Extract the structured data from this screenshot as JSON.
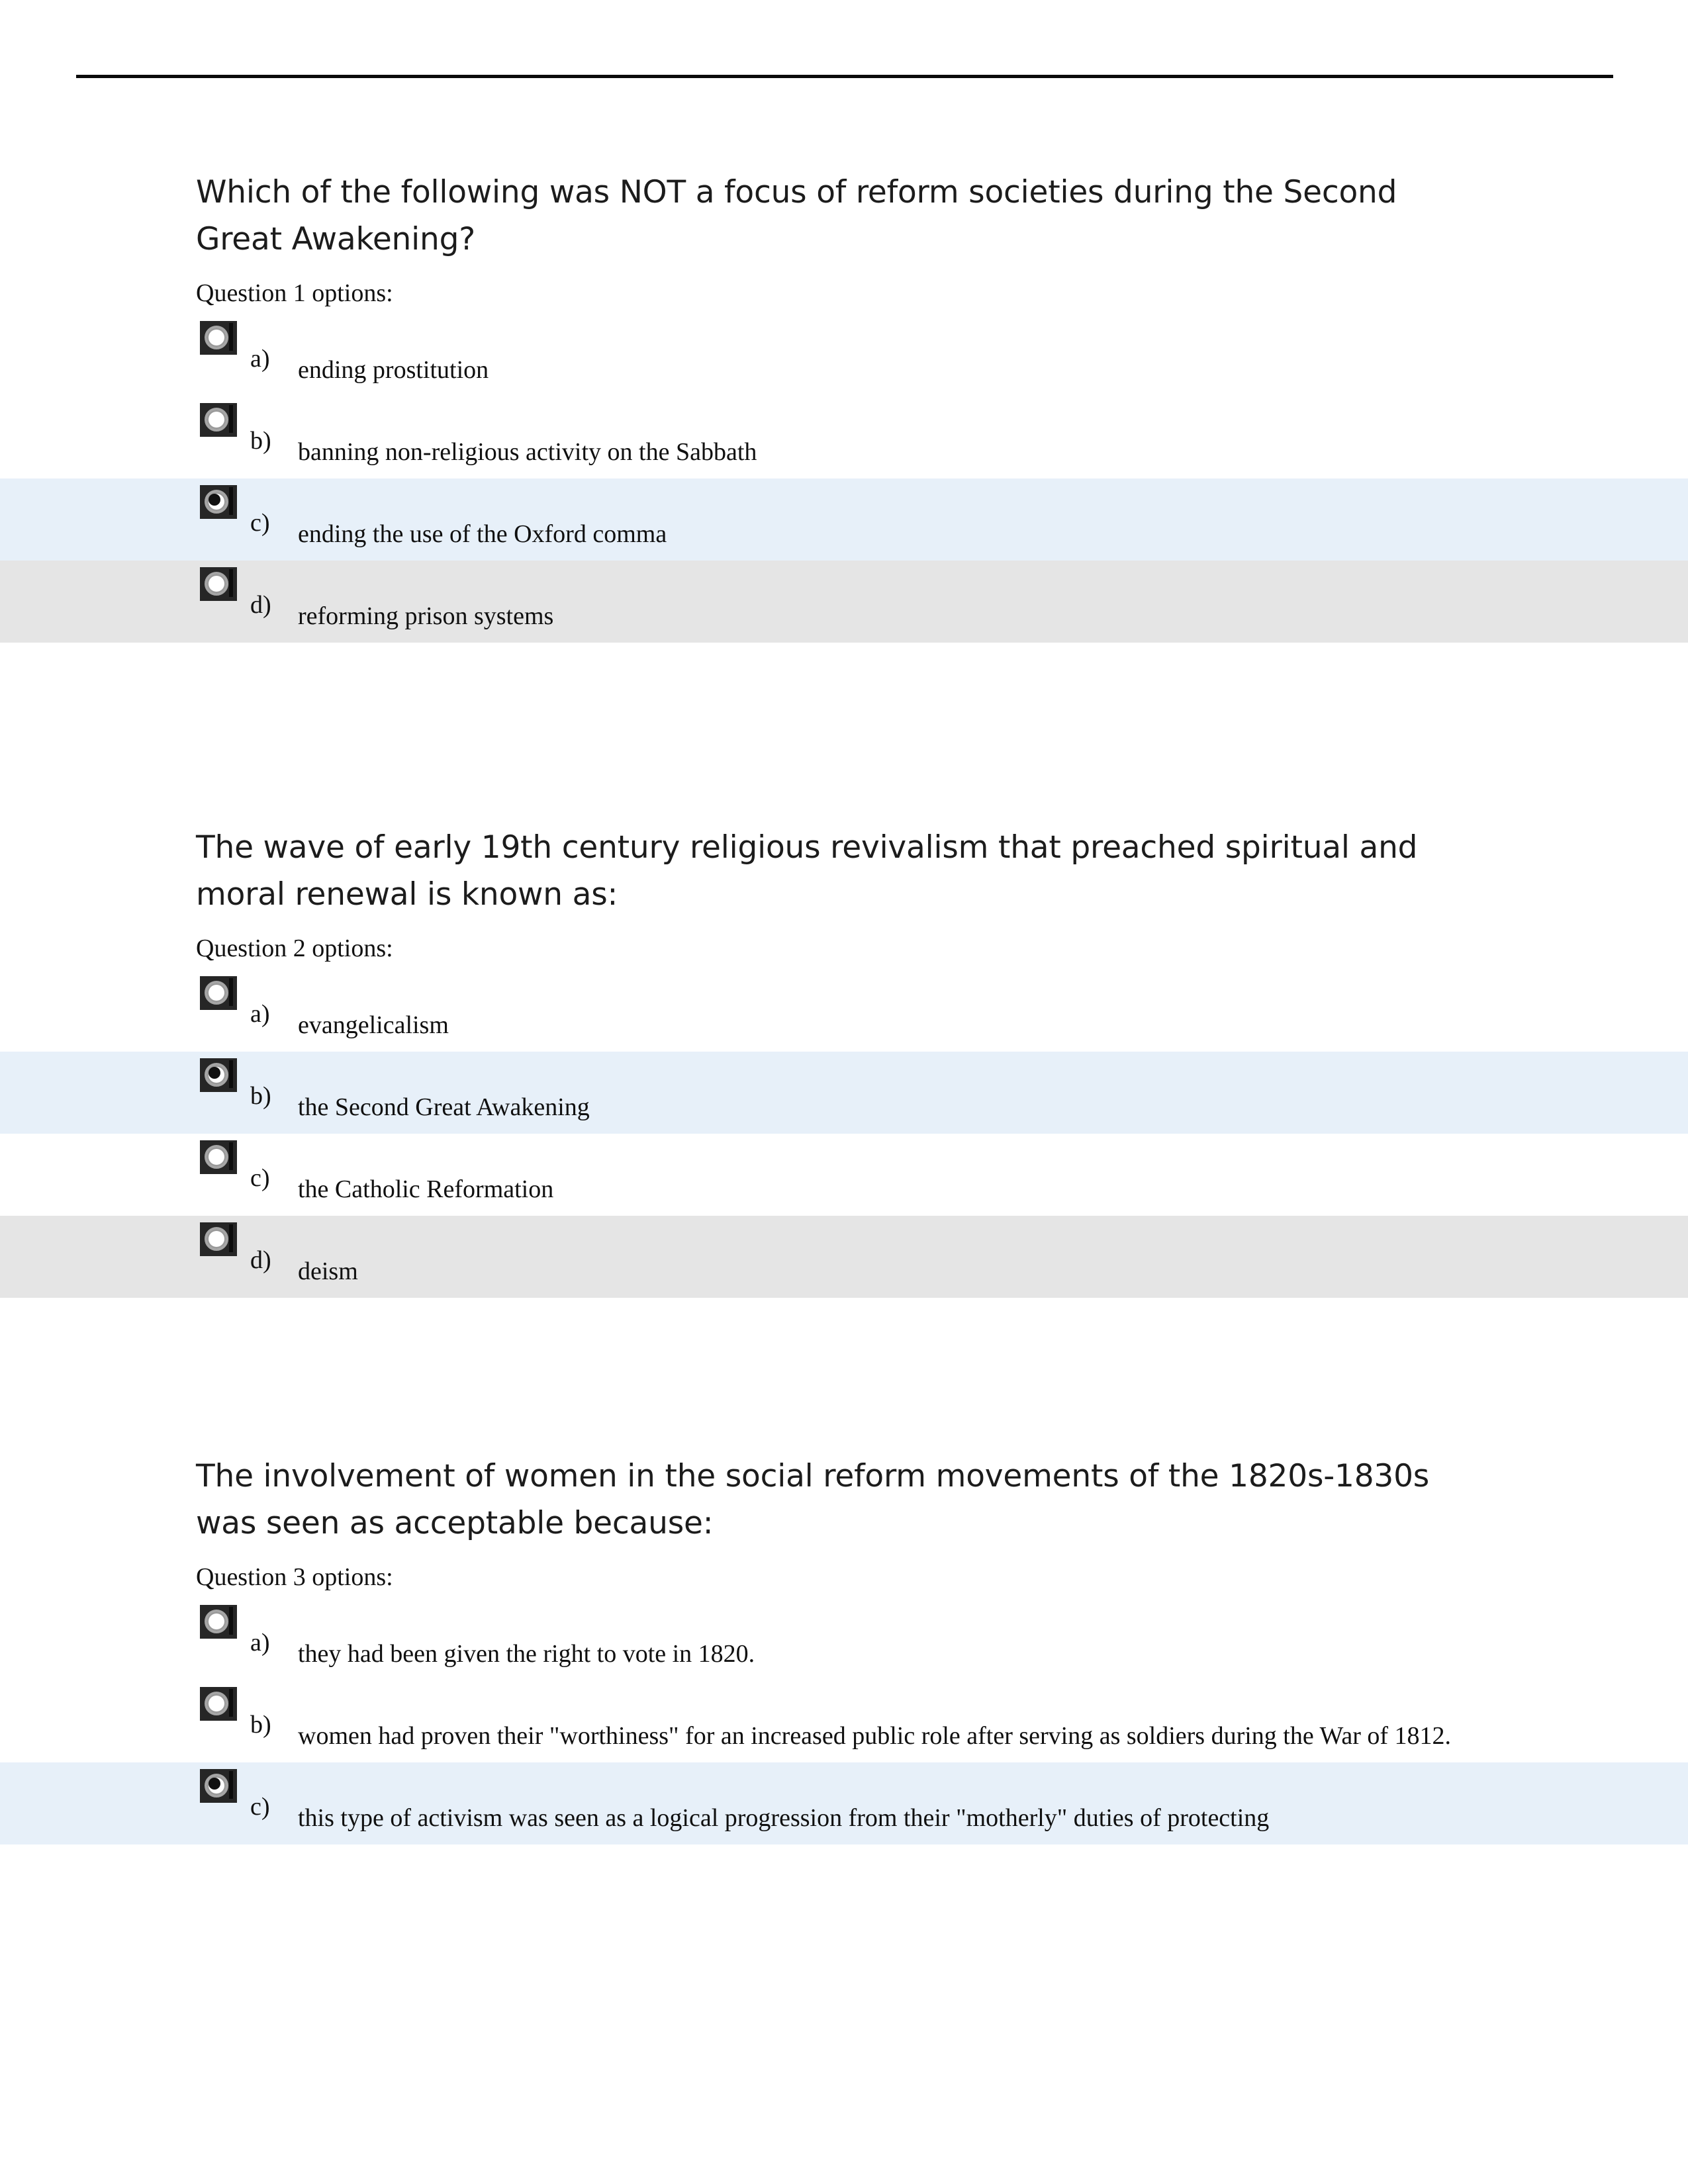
{
  "document": {
    "title": "Quiz — Second Great Awakening and Reform Societies",
    "page_background": "#ffffff",
    "rule_color": "#0a0a0a",
    "highlight_selected_color": "#e7f0f9",
    "highlight_alternate_color": "#e5e5e5",
    "radio_control_color": "#262626"
  },
  "questions": [
    {
      "number": "1",
      "prompt": "Which of the following was NOT a focus of reform societies during the Second Great Awakening?",
      "options_label": "Question 1 options:",
      "options": [
        {
          "letter": "a)",
          "text": "ending prostitution",
          "selected": false,
          "row_style": "plain"
        },
        {
          "letter": "b)",
          "text": "banning non-religious activity on the Sabbath",
          "selected": false,
          "row_style": "plain"
        },
        {
          "letter": "c)",
          "text": "ending the use of the Oxford comma",
          "selected": true,
          "row_style": "blue"
        },
        {
          "letter": "d)",
          "text": "reforming prison systems",
          "selected": false,
          "row_style": "gray"
        }
      ]
    },
    {
      "number": "2",
      "prompt": "The wave of early 19th century religious revivalism that preached spiritual and moral renewal is known as:",
      "options_label": "Question 2 options:",
      "options": [
        {
          "letter": "a)",
          "text": "evangelicalism",
          "selected": false,
          "row_style": "plain"
        },
        {
          "letter": "b)",
          "text": "the Second Great Awakening",
          "selected": true,
          "row_style": "blue"
        },
        {
          "letter": "c)",
          "text": "the Catholic Reformation",
          "selected": false,
          "row_style": "plain"
        },
        {
          "letter": "d)",
          "text": "deism",
          "selected": false,
          "row_style": "gray"
        }
      ]
    },
    {
      "number": "3",
      "prompt": "The involvement of women in the social reform movements of the 1820s-1830s was seen as acceptable because:",
      "options_label": "Question 3 options:",
      "options": [
        {
          "letter": "a)",
          "text": "they had been given the right to vote in 1820.",
          "selected": false,
          "row_style": "plain"
        },
        {
          "letter": "b)",
          "text": "women had proven their \"worthiness\" for an increased public role after serving as soldiers during the War of 1812.",
          "selected": false,
          "row_style": "plain"
        },
        {
          "letter": "c)",
          "text": "this type of activism was seen as a logical progression from their \"motherly\" duties of protecting",
          "selected": true,
          "row_style": "blue"
        }
      ]
    }
  ]
}
